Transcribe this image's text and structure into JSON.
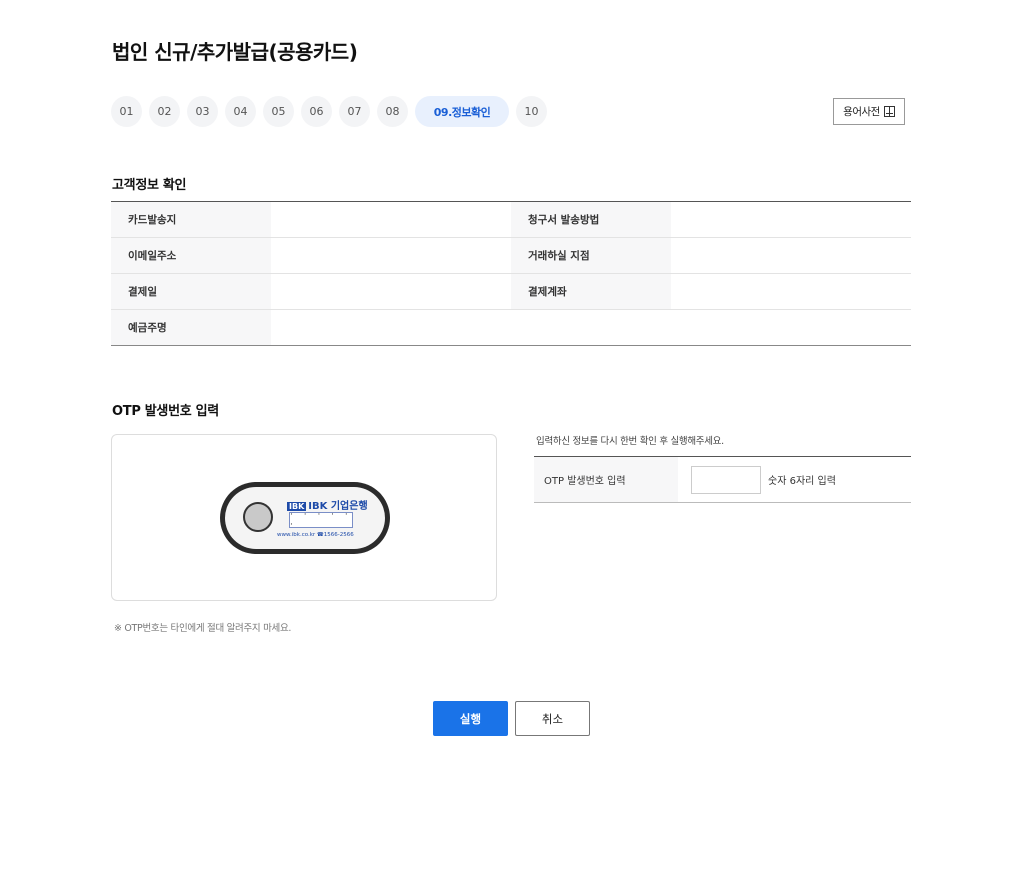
{
  "page": {
    "title": "법인 신규/추가발급(공용카드)"
  },
  "steps": {
    "items": [
      "01",
      "02",
      "03",
      "04",
      "05",
      "06",
      "07",
      "08",
      "09.정보확인",
      "10"
    ],
    "active_index": 8
  },
  "dictionary_button": {
    "label": "용어사전",
    "icon": "book-icon"
  },
  "customer_info": {
    "title": "고객정보 확인",
    "rows": [
      {
        "label1": "카드발송지",
        "value1": "",
        "label2": "청구서 발송방법",
        "value2": ""
      },
      {
        "label1": "이메일주소",
        "value1": "",
        "label2": "거래하실 지점",
        "value2": ""
      },
      {
        "label1": "결제일",
        "value1": "",
        "label2": "결제계좌",
        "value2": ""
      },
      {
        "label1": "예금주명",
        "value1": ""
      }
    ]
  },
  "otp": {
    "title": "OTP 발생번호 입력",
    "device": {
      "brand_tag": "IBK",
      "brand_name": "IBK 기업은행",
      "screen": "· · · · · ·",
      "url_text": "www.ibk.co.kr ☎1566-2566"
    },
    "note": "※ OTP번호는 타인에게 절대 알려주지 마세요.",
    "guide": "입력하신 정보를 다시 한번 확인 후 실행해주세요.",
    "input_label": "OTP 발생번호 입력",
    "input_value": "",
    "input_hint": "숫자 6자리 입력"
  },
  "buttons": {
    "execute": "실행",
    "cancel": "취소"
  },
  "colors": {
    "primary": "#1a73e8",
    "step_active_bg": "#e8f0fd",
    "step_active_text": "#1a5fd6"
  }
}
